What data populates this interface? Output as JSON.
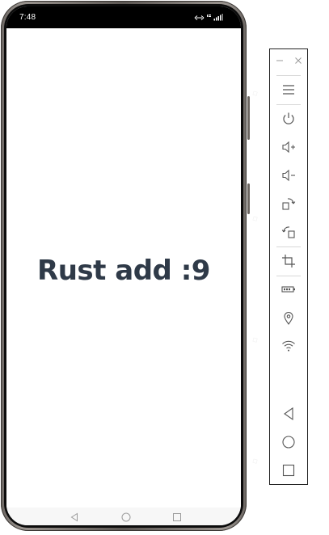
{
  "status_bar": {
    "time": "7:48",
    "icons": [
      "data-transfer-icon",
      "network-type-icon",
      "signal-icon"
    ]
  },
  "app": {
    "result_text": "Rust add :9"
  },
  "navigation_bar": {
    "buttons": [
      "back-icon",
      "home-icon",
      "recents-icon"
    ]
  },
  "emulator_toolbar": {
    "window_controls": [
      "minimize-icon",
      "close-icon"
    ],
    "buttons": [
      "menu-icon",
      "power-icon",
      "volume-up-icon",
      "volume-down-icon",
      "rotate-right-icon",
      "rotate-left-icon",
      "screenshot-crop-icon",
      "battery-icon",
      "location-icon",
      "wifi-icon",
      "back-icon",
      "home-icon",
      "recents-icon"
    ]
  }
}
